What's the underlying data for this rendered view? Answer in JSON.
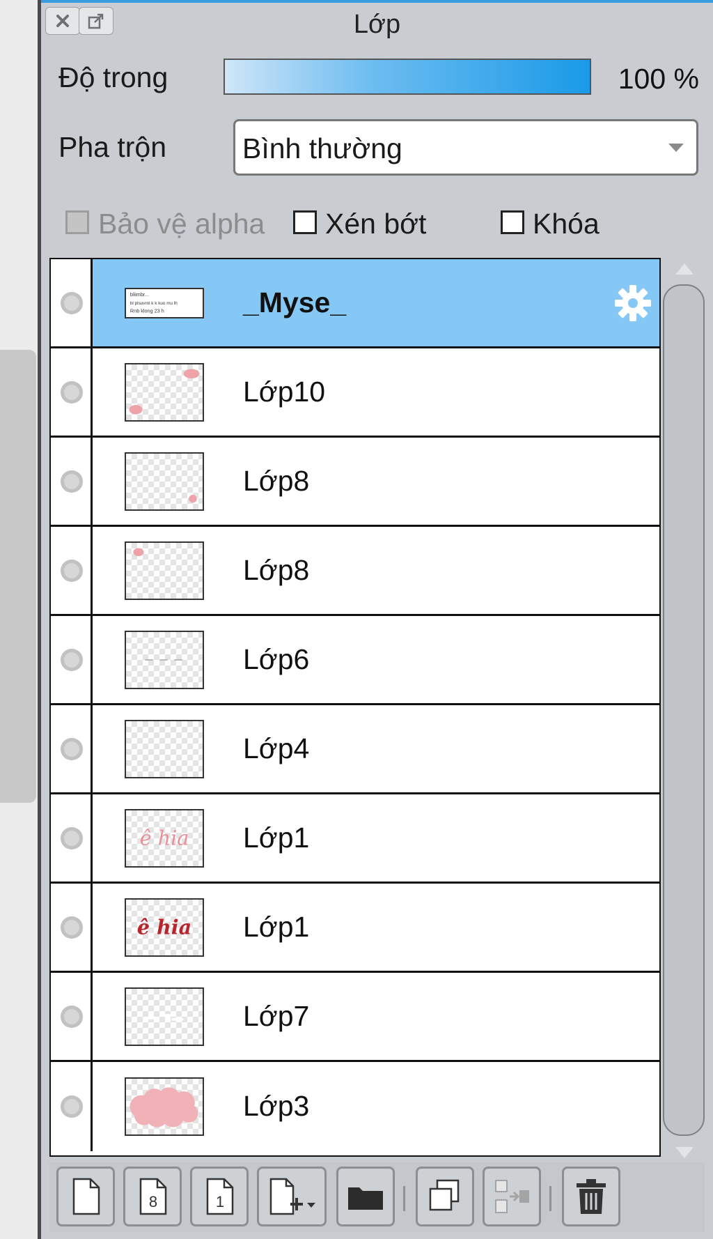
{
  "panel": {
    "title": "Lớp"
  },
  "opacity": {
    "label": "Độ trong",
    "value_text": "100 %",
    "value": 100
  },
  "blend": {
    "label": "Pha trộn",
    "selected": "Bình thường"
  },
  "checkboxes": [
    {
      "label": "Bảo vệ alpha",
      "checked": false,
      "enabled": false
    },
    {
      "label": "Xén bớt",
      "checked": false,
      "enabled": true
    },
    {
      "label": "Khóa",
      "checked": false,
      "enabled": true
    }
  ],
  "layers": [
    {
      "name": "_Myse_",
      "selected": true,
      "thumb": "text"
    },
    {
      "name": "Lớp10",
      "selected": false,
      "thumb": "pink-corners"
    },
    {
      "name": "Lớp8",
      "selected": false,
      "thumb": "pink-dot-bottom-right"
    },
    {
      "name": "Lớp8",
      "selected": false,
      "thumb": "pink-dot-top-left"
    },
    {
      "name": "Lớp6",
      "selected": false,
      "thumb": "faint-dashes"
    },
    {
      "name": "Lớp4",
      "selected": false,
      "thumb": "empty"
    },
    {
      "name": "Lớp1",
      "selected": false,
      "thumb": "script-light"
    },
    {
      "name": "Lớp1",
      "selected": false,
      "thumb": "script-dark"
    },
    {
      "name": "Lớp7",
      "selected": false,
      "thumb": "white-text"
    },
    {
      "name": "Lớp3",
      "selected": false,
      "thumb": "pink-cloud"
    }
  ],
  "thumb_text": {
    "line1": "bliimbr...",
    "line2": "bl plsuvrnl k k kuo mu lh",
    "line3": "Rnb klong 23 h"
  },
  "thumb_script": "ê hia",
  "toolbar_buttons": [
    {
      "name": "new-raster-layer-button",
      "icon": "page-icon"
    },
    {
      "name": "new-8bit-layer-button",
      "icon": "page-8-icon",
      "glyph": "8"
    },
    {
      "name": "new-1bit-layer-button",
      "icon": "page-1-icon",
      "glyph": "1"
    },
    {
      "name": "new-layer-menu-button",
      "icon": "page-plus-icon"
    },
    {
      "name": "new-folder-button",
      "icon": "folder-icon"
    },
    {
      "name": "duplicate-layer-button",
      "icon": "duplicate-icon"
    },
    {
      "name": "merge-down-button",
      "icon": "merge-down-icon"
    },
    {
      "name": "delete-layer-button",
      "icon": "trash-icon"
    }
  ],
  "colors": {
    "accent": "#1a9ae8",
    "selected_row": "#86c8f5",
    "panel_bg": "#c9cdd1"
  }
}
